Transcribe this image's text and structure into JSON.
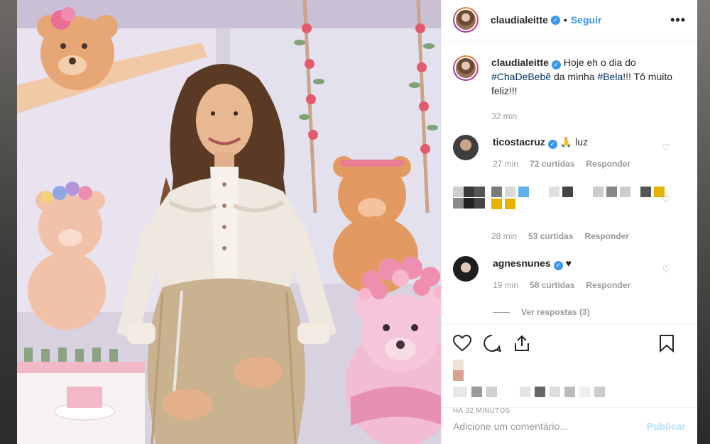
{
  "post": {
    "username": "claudialeitte",
    "verified_mark": "✓",
    "separator": "•",
    "follow_label": "Seguir",
    "more_icon": "•••"
  },
  "caption": {
    "username": "claudialeitte",
    "text_before": "Hoje eh o dia do",
    "hashtag1": "#ChaDeBebê",
    "text_middle": "da minha",
    "hashtag2": "#Bela",
    "text_after": "!!! Tô muito feliz!!!",
    "time": "32 min"
  },
  "comments": [
    {
      "username": "ticostacruz",
      "text": "🙏 luz",
      "time": "27 min",
      "likes": "72 curtidas",
      "reply": "Responder"
    },
    {
      "username": "",
      "text": "",
      "time": "28 min",
      "likes": "53 curtidas",
      "reply": "Responder"
    },
    {
      "username": "agnesnunes",
      "text": "♥",
      "time": "19 min",
      "likes": "58 curtidas",
      "reply": "Responder"
    }
  ],
  "view_replies": "Ver respostas (3)",
  "timestamp": "HÁ 32 MINUTOS",
  "add_comment": {
    "placeholder": "Adicione um comentário...",
    "publish": "Publicar"
  },
  "colors": {
    "link": "#3897f0",
    "hashtag": "#003569",
    "muted": "#999999"
  }
}
